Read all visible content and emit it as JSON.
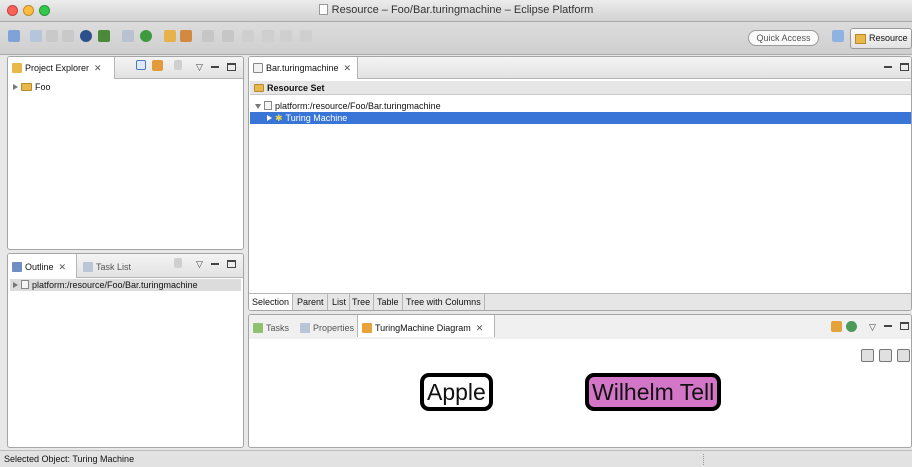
{
  "window": {
    "title": "Resource – Foo/Bar.turingmachine – Eclipse Platform"
  },
  "toolbar": {
    "quick_access": "Quick Access",
    "perspective": "Resource"
  },
  "project_explorer": {
    "tab_label": "Project Explorer",
    "close_glyph": "✕",
    "items": [
      {
        "label": "Foo"
      }
    ]
  },
  "outline": {
    "tab_label": "Outline",
    "close_glyph": "✕",
    "task_list_label": "Task List",
    "items": [
      {
        "label": "platform:/resource/Foo/Bar.turingmachine"
      }
    ]
  },
  "editor": {
    "tab_label": "Bar.turingmachine",
    "close_glyph": "✕",
    "tree": {
      "root": "Resource Set",
      "child": "platform:/resource/Foo/Bar.turingmachine",
      "grandchild": "Turing Machine"
    },
    "bottom_tabs": [
      "Selection",
      "Parent",
      "List",
      "Tree",
      "Table",
      "Tree with Columns"
    ]
  },
  "lower_panel": {
    "tabs": [
      {
        "label": "Tasks"
      },
      {
        "label": "Properties"
      },
      {
        "label": "TuringMachine Diagram"
      }
    ],
    "close_glyph": "✕",
    "nodes": [
      {
        "label": "Apple",
        "color": "#ffffff"
      },
      {
        "label": "Wilhelm Tell",
        "color": "#d376c8"
      }
    ]
  },
  "status": {
    "text": "Selected Object: Turing Machine"
  },
  "colors": {
    "selection": "#3875d7",
    "folder": "#e8b84a"
  }
}
